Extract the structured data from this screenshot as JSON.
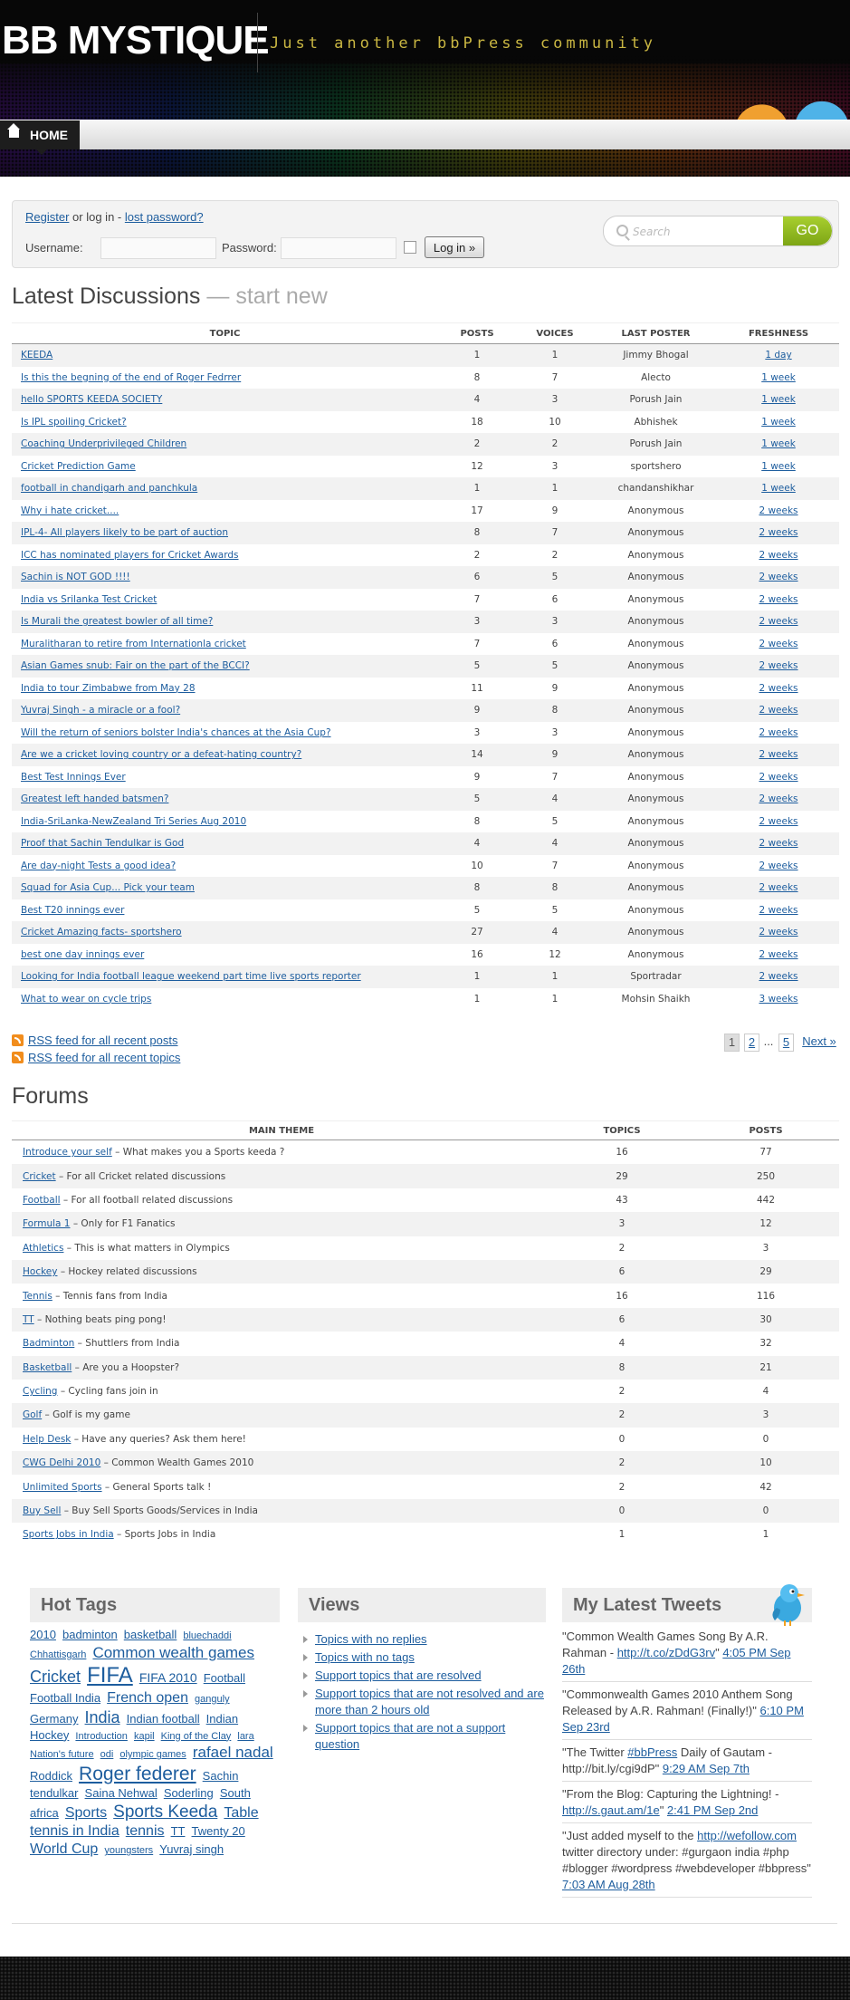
{
  "header": {
    "logo": "BB MYSTIQUE",
    "tagline": "Just another bbPress community"
  },
  "nav": {
    "home_label": "HOME"
  },
  "login": {
    "register_label": "Register",
    "or_login_text": "or log in -",
    "lost_password_label": "lost password?",
    "username_label": "Username:",
    "password_label": "Password:",
    "login_button_label": "Log in »"
  },
  "search": {
    "placeholder": "Search",
    "button_label": "GO"
  },
  "latest": {
    "title": "Latest Discussions",
    "start_new": "— start new",
    "columns": [
      "TOPIC",
      "POSTS",
      "VOICES",
      "LAST POSTER",
      "FRESHNESS"
    ],
    "rows": [
      {
        "topic": "KEEDA",
        "posts": "1",
        "voices": "1",
        "last_poster": "Jimmy Bhogal",
        "freshness": "1 day"
      },
      {
        "topic": "Is this the begning of the end of Roger Fedrrer",
        "posts": "8",
        "voices": "7",
        "last_poster": "Alecto",
        "freshness": "1 week"
      },
      {
        "topic": "hello SPORTS KEEDA SOCIETY",
        "posts": "4",
        "voices": "3",
        "last_poster": "Porush Jain",
        "freshness": "1 week"
      },
      {
        "topic": "Is IPL spoiling Cricket?",
        "posts": "18",
        "voices": "10",
        "last_poster": "Abhishek",
        "freshness": "1 week"
      },
      {
        "topic": "Coaching Underprivileged Children",
        "posts": "2",
        "voices": "2",
        "last_poster": "Porush Jain",
        "freshness": "1 week"
      },
      {
        "topic": "Cricket Prediction Game",
        "posts": "12",
        "voices": "3",
        "last_poster": "sportshero",
        "freshness": "1 week"
      },
      {
        "topic": "football in chandigarh and panchkula",
        "posts": "1",
        "voices": "1",
        "last_poster": "chandanshikhar",
        "freshness": "1 week"
      },
      {
        "topic": "Why i hate cricket....",
        "posts": "17",
        "voices": "9",
        "last_poster": "Anonymous",
        "freshness": "2 weeks"
      },
      {
        "topic": "IPL-4- All players likely to be part of auction",
        "posts": "8",
        "voices": "7",
        "last_poster": "Anonymous",
        "freshness": "2 weeks"
      },
      {
        "topic": "ICC has nominated players for Cricket Awards",
        "posts": "2",
        "voices": "2",
        "last_poster": "Anonymous",
        "freshness": "2 weeks"
      },
      {
        "topic": "Sachin is NOT GOD !!!!",
        "posts": "6",
        "voices": "5",
        "last_poster": "Anonymous",
        "freshness": "2 weeks"
      },
      {
        "topic": "India vs Srilanka Test Cricket",
        "posts": "7",
        "voices": "6",
        "last_poster": "Anonymous",
        "freshness": "2 weeks"
      },
      {
        "topic": "Is Murali the greatest bowler of all time?",
        "posts": "3",
        "voices": "3",
        "last_poster": "Anonymous",
        "freshness": "2 weeks"
      },
      {
        "topic": "Muralitharan to retire from Internationla cricket",
        "posts": "7",
        "voices": "6",
        "last_poster": "Anonymous",
        "freshness": "2 weeks"
      },
      {
        "topic": "Asian Games snub: Fair on the part of the BCCI?",
        "posts": "5",
        "voices": "5",
        "last_poster": "Anonymous",
        "freshness": "2 weeks"
      },
      {
        "topic": "India to tour Zimbabwe from May 28",
        "posts": "11",
        "voices": "9",
        "last_poster": "Anonymous",
        "freshness": "2 weeks"
      },
      {
        "topic": "Yuvraj Singh - a miracle or a fool?",
        "posts": "9",
        "voices": "8",
        "last_poster": "Anonymous",
        "freshness": "2 weeks"
      },
      {
        "topic": "Will the return of seniors bolster India's chances at the Asia Cup?",
        "posts": "3",
        "voices": "3",
        "last_poster": "Anonymous",
        "freshness": "2 weeks"
      },
      {
        "topic": "Are we a cricket loving country or a defeat-hating country?",
        "posts": "14",
        "voices": "9",
        "last_poster": "Anonymous",
        "freshness": "2 weeks"
      },
      {
        "topic": "Best Test Innings Ever",
        "posts": "9",
        "voices": "7",
        "last_poster": "Anonymous",
        "freshness": "2 weeks"
      },
      {
        "topic": "Greatest left handed batsmen?",
        "posts": "5",
        "voices": "4",
        "last_poster": "Anonymous",
        "freshness": "2 weeks"
      },
      {
        "topic": "India-SriLanka-NewZealand Tri Series Aug 2010",
        "posts": "8",
        "voices": "5",
        "last_poster": "Anonymous",
        "freshness": "2 weeks"
      },
      {
        "topic": "Proof that Sachin Tendulkar is God",
        "posts": "4",
        "voices": "4",
        "last_poster": "Anonymous",
        "freshness": "2 weeks"
      },
      {
        "topic": "Are day-night Tests a good idea?",
        "posts": "10",
        "voices": "7",
        "last_poster": "Anonymous",
        "freshness": "2 weeks"
      },
      {
        "topic": "Squad for Asia Cup... Pick your team",
        "posts": "8",
        "voices": "8",
        "last_poster": "Anonymous",
        "freshness": "2 weeks"
      },
      {
        "topic": "Best T20 innings ever",
        "posts": "5",
        "voices": "5",
        "last_poster": "Anonymous",
        "freshness": "2 weeks"
      },
      {
        "topic": "Cricket Amazing facts- sportshero",
        "posts": "27",
        "voices": "4",
        "last_poster": "Anonymous",
        "freshness": "2 weeks"
      },
      {
        "topic": "best one day innings ever",
        "posts": "16",
        "voices": "12",
        "last_poster": "Anonymous",
        "freshness": "2 weeks"
      },
      {
        "topic": "Looking for India football league weekend part time live sports reporter",
        "posts": "1",
        "voices": "1",
        "last_poster": "Sportradar",
        "freshness": "2 weeks"
      },
      {
        "topic": "What to wear on cycle trips",
        "posts": "1",
        "voices": "1",
        "last_poster": "Mohsin Shaikh",
        "freshness": "3 weeks"
      }
    ]
  },
  "feeds": {
    "posts_label": "RSS feed for all recent posts",
    "topics_label": "RSS feed for all recent topics"
  },
  "pagination": {
    "current": "1",
    "page2": "2",
    "ellipsis": "...",
    "last": "5",
    "next": "Next »"
  },
  "forums": {
    "title": "Forums",
    "columns": [
      "MAIN THEME",
      "TOPICS",
      "POSTS"
    ],
    "rows": [
      {
        "name": "Introduce your self",
        "desc": " – What makes you a Sports keeda ?",
        "topics": "16",
        "posts": "77"
      },
      {
        "name": "Cricket",
        "desc": " – For all Cricket related discussions",
        "topics": "29",
        "posts": "250"
      },
      {
        "name": "Football",
        "desc": " – For all football related discussions",
        "topics": "43",
        "posts": "442"
      },
      {
        "name": "Formula 1",
        "desc": " – Only for F1 Fanatics",
        "topics": "3",
        "posts": "12"
      },
      {
        "name": "Athletics",
        "desc": " – This is what matters in Olympics",
        "topics": "2",
        "posts": "3"
      },
      {
        "name": "Hockey",
        "desc": " – Hockey related discussions",
        "topics": "6",
        "posts": "29"
      },
      {
        "name": "Tennis",
        "desc": " – Tennis fans from India",
        "topics": "16",
        "posts": "116"
      },
      {
        "name": "TT",
        "desc": " – Nothing beats ping pong!",
        "topics": "6",
        "posts": "30"
      },
      {
        "name": "Badminton",
        "desc": " – Shuttlers from India",
        "topics": "4",
        "posts": "32"
      },
      {
        "name": "Basketball",
        "desc": " – Are you a Hoopster?",
        "topics": "8",
        "posts": "21"
      },
      {
        "name": "Cycling",
        "desc": " – Cycling fans join in",
        "topics": "2",
        "posts": "4"
      },
      {
        "name": "Golf",
        "desc": " – Golf is my game",
        "topics": "2",
        "posts": "3"
      },
      {
        "name": "Help Desk",
        "desc": " – Have any queries? Ask them here!",
        "topics": "0",
        "posts": "0"
      },
      {
        "name": "CWG Delhi 2010",
        "desc": " – Common Wealth Games 2010",
        "topics": "2",
        "posts": "10"
      },
      {
        "name": "Unlimited Sports",
        "desc": " – General Sports talk !",
        "topics": "2",
        "posts": "42"
      },
      {
        "name": "Buy Sell",
        "desc": " – Buy Sell Sports Goods/Services in India",
        "topics": "0",
        "posts": "0"
      },
      {
        "name": "Sports Jobs in India",
        "desc": " – Sports Jobs in India",
        "topics": "1",
        "posts": "1"
      }
    ]
  },
  "hot_tags": {
    "title": "Hot Tags",
    "tags": [
      {
        "label": "2010",
        "size": 13
      },
      {
        "label": "badminton",
        "size": 13
      },
      {
        "label": "basketball",
        "size": 13
      },
      {
        "label": "bluechaddi",
        "size": 11
      },
      {
        "label": "Chhattisgarh",
        "size": 11
      },
      {
        "label": "Common wealth games",
        "size": 17
      },
      {
        "label": "Cricket",
        "size": 18
      },
      {
        "label": "FIFA",
        "size": 24
      },
      {
        "label": "FIFA 2010",
        "size": 14
      },
      {
        "label": "Football",
        "size": 13
      },
      {
        "label": "Football India",
        "size": 13
      },
      {
        "label": "French open",
        "size": 16
      },
      {
        "label": "ganguly",
        "size": 11
      },
      {
        "label": "Germany",
        "size": 13
      },
      {
        "label": "India",
        "size": 18
      },
      {
        "label": "Indian football",
        "size": 13
      },
      {
        "label": "Indian Hockey",
        "size": 13
      },
      {
        "label": "Introduction",
        "size": 11
      },
      {
        "label": "kapil",
        "size": 11
      },
      {
        "label": "King of the Clay",
        "size": 11
      },
      {
        "label": "lara",
        "size": 11
      },
      {
        "label": "Nation's future",
        "size": 11
      },
      {
        "label": "odi",
        "size": 11
      },
      {
        "label": "olympic games",
        "size": 11
      },
      {
        "label": "rafael nadal",
        "size": 17
      },
      {
        "label": "Roddick",
        "size": 13
      },
      {
        "label": "Roger federer",
        "size": 21
      },
      {
        "label": "Sachin tendulkar",
        "size": 13
      },
      {
        "label": "Saina Nehwal",
        "size": 13
      },
      {
        "label": "Soderling",
        "size": 13
      },
      {
        "label": "South africa",
        "size": 13
      },
      {
        "label": "Sports",
        "size": 16
      },
      {
        "label": "Sports Keeda",
        "size": 19
      },
      {
        "label": "Table tennis in India",
        "size": 16
      },
      {
        "label": "tennis",
        "size": 16
      },
      {
        "label": "TT",
        "size": 13
      },
      {
        "label": "Twenty 20",
        "size": 13
      },
      {
        "label": "World Cup",
        "size": 16
      },
      {
        "label": "youngsters",
        "size": 11
      },
      {
        "label": "Yuvraj singh",
        "size": 13
      }
    ]
  },
  "views": {
    "title": "Views",
    "items": [
      "Topics with no replies",
      "Topics with no tags",
      "Support topics that are resolved",
      "Support topics that are not resolved and are more than 2 hours old",
      "Support topics that are not a support question"
    ]
  },
  "tweets": {
    "title": "My Latest Tweets",
    "items": [
      {
        "text": "\"Common Wealth Games Song By A.R. Rahman - ",
        "link": "http://t.co/zDdG3rv",
        "after": "\" ",
        "time": "4:05 PM Sep 26th"
      },
      {
        "text": "\"Commonwealth Games 2010 Anthem Song Released by A.R. Rahman! (Finally!)\" ",
        "link": "",
        "after": "",
        "time": "6:10 PM Sep 23rd"
      },
      {
        "text": "\"The Twitter ",
        "link": "#bbPress",
        "after": " Daily of Gautam - http://bit.ly/cgi9dP\" ",
        "time": "9:29 AM Sep 7th"
      },
      {
        "text": "\"From the Blog: Capturing the Lightning! - ",
        "link": "http://s.gaut.am/1e",
        "after": "\" ",
        "time": "2:41 PM Sep 2nd"
      },
      {
        "text": "\"Just added myself to the ",
        "link": "http://wefollow.com",
        "after": " twitter directory under: #gurgaon india #php #blogger #wordpress #webdeveloper #bbpress\" ",
        "time": "7:03 AM Aug 28th"
      }
    ]
  },
  "colors": {
    "link": "#1d5d9e",
    "go_button": "#8db81f",
    "rss": "#f18d1d"
  }
}
